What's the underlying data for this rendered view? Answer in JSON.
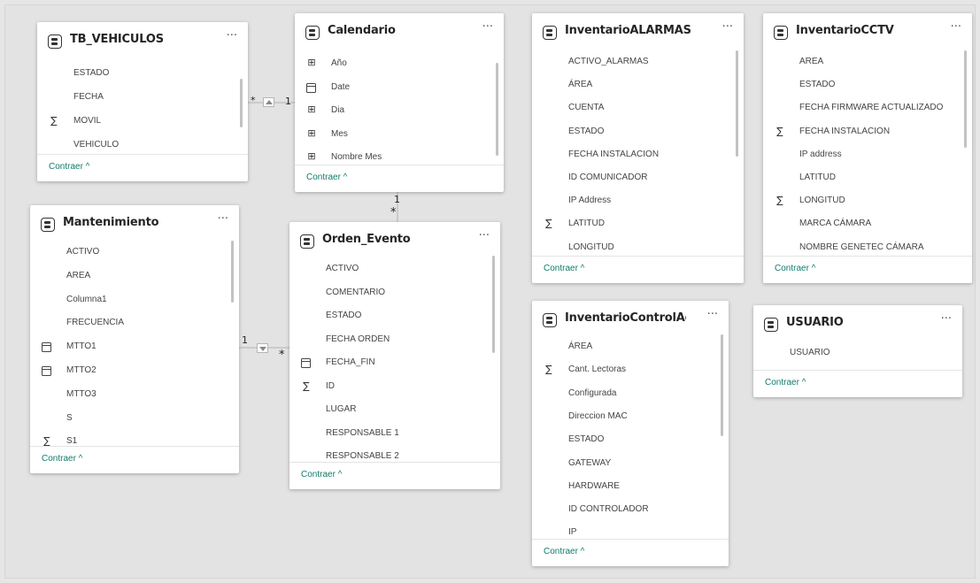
{
  "collapse_label": "Contraer ^",
  "more_label": "···",
  "relationships": {
    "vehiculos_calendario": {
      "many": "*",
      "one": "1"
    },
    "calendario_orden": {
      "one": "1",
      "many": "*"
    },
    "mantenimiento_orden": {
      "one": "1",
      "many": "*"
    }
  },
  "tables": [
    {
      "id": "tb_vehiculos",
      "title": "TB_VEHICULOS",
      "fields": [
        {
          "name": "ESTADO",
          "icon": ""
        },
        {
          "name": "FECHA",
          "icon": ""
        },
        {
          "name": "MOVIL",
          "icon": "sum"
        },
        {
          "name": "VEHICULO",
          "icon": ""
        }
      ]
    },
    {
      "id": "calendario",
      "title": "Calendario",
      "fields": [
        {
          "name": "Año",
          "icon": "hierarchy"
        },
        {
          "name": "Date",
          "icon": "calendar"
        },
        {
          "name": "Dia",
          "icon": "hierarchy"
        },
        {
          "name": "Mes",
          "icon": "hierarchy"
        },
        {
          "name": "Nombre Mes",
          "icon": "hierarchy"
        }
      ]
    },
    {
      "id": "inventario_alarmas",
      "title": "InventarioALARMAS",
      "fields": [
        {
          "name": "ACTIVO_ALARMAS",
          "icon": ""
        },
        {
          "name": "ÁREA",
          "icon": ""
        },
        {
          "name": "CUENTA",
          "icon": ""
        },
        {
          "name": "ESTADO",
          "icon": ""
        },
        {
          "name": "FECHA INSTALACION",
          "icon": ""
        },
        {
          "name": "ID COMUNICADOR",
          "icon": ""
        },
        {
          "name": "IP Address",
          "icon": ""
        },
        {
          "name": "LATITUD",
          "icon": "sum"
        },
        {
          "name": "LONGITUD",
          "icon": ""
        }
      ]
    },
    {
      "id": "inventario_cctv",
      "title": "InventarioCCTV",
      "fields": [
        {
          "name": "AREA",
          "icon": ""
        },
        {
          "name": "ESTADO",
          "icon": ""
        },
        {
          "name": "FECHA FIRMWARE ACTUALIZADO",
          "icon": ""
        },
        {
          "name": "FECHA INSTALACION",
          "icon": "sum"
        },
        {
          "name": "IP address",
          "icon": ""
        },
        {
          "name": "LATITUD",
          "icon": ""
        },
        {
          "name": "LONGITUD",
          "icon": "sum"
        },
        {
          "name": "MARCA CÁMARA",
          "icon": ""
        },
        {
          "name": "NOMBRE GENETEC CÁMARA",
          "icon": ""
        }
      ]
    },
    {
      "id": "mantenimiento",
      "title": "Mantenimiento",
      "fields": [
        {
          "name": "ACTIVO",
          "icon": ""
        },
        {
          "name": "AREA",
          "icon": ""
        },
        {
          "name": "Columna1",
          "icon": ""
        },
        {
          "name": "FRECUENCIA",
          "icon": ""
        },
        {
          "name": "MTTO1",
          "icon": "calendar"
        },
        {
          "name": "MTTO2",
          "icon": "calendar"
        },
        {
          "name": "MTTO3",
          "icon": ""
        },
        {
          "name": "S",
          "icon": ""
        },
        {
          "name": "S1",
          "icon": "sum"
        }
      ]
    },
    {
      "id": "orden_evento",
      "title": "Orden_Evento",
      "fields": [
        {
          "name": "ACTIVO",
          "icon": ""
        },
        {
          "name": "COMENTARIO",
          "icon": ""
        },
        {
          "name": "ESTADO",
          "icon": ""
        },
        {
          "name": "FECHA ORDEN",
          "icon": ""
        },
        {
          "name": "FECHA_FIN",
          "icon": "calendar"
        },
        {
          "name": "ID",
          "icon": "sum"
        },
        {
          "name": "LUGAR",
          "icon": ""
        },
        {
          "name": "RESPONSABLE 1",
          "icon": ""
        },
        {
          "name": "RESPONSABLE 2",
          "icon": ""
        }
      ]
    },
    {
      "id": "inventario_control_acceso",
      "title": "InventarioControlAcc...",
      "fields": [
        {
          "name": "ÁREA",
          "icon": ""
        },
        {
          "name": "Cant. Lectoras",
          "icon": "sum"
        },
        {
          "name": "Configurada",
          "icon": ""
        },
        {
          "name": "Direccion MAC",
          "icon": ""
        },
        {
          "name": "ESTADO",
          "icon": ""
        },
        {
          "name": "GATEWAY",
          "icon": ""
        },
        {
          "name": "HARDWARE",
          "icon": ""
        },
        {
          "name": "ID CONTROLADOR",
          "icon": ""
        },
        {
          "name": "IP",
          "icon": ""
        }
      ]
    },
    {
      "id": "usuario",
      "title": "USUARIO",
      "fields": [
        {
          "name": "USUARIO",
          "icon": ""
        }
      ]
    }
  ]
}
